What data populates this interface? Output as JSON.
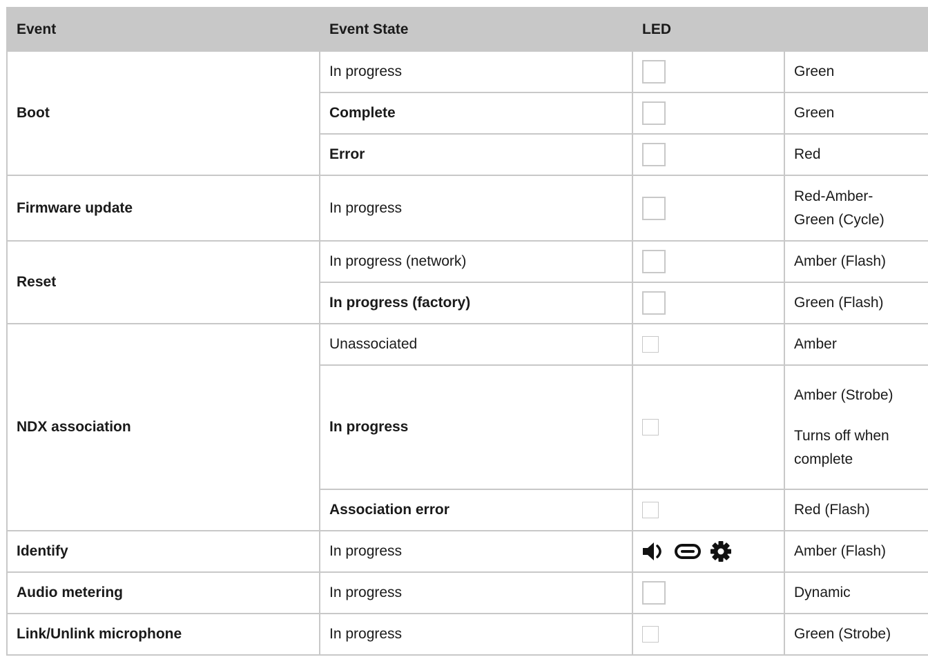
{
  "headers": {
    "event": "Event",
    "state": "Event State",
    "led": "LED"
  },
  "rows": [
    {
      "event": "Boot",
      "state": "In progress",
      "state_bold": false,
      "color": "Green",
      "swatch": "square"
    },
    {
      "event": "",
      "state": "Complete",
      "state_bold": true,
      "color": "Green",
      "swatch": "square"
    },
    {
      "event": "",
      "state": "Error",
      "state_bold": true,
      "color": "Red",
      "swatch": "square"
    },
    {
      "event": "Firmware update",
      "state": "In progress",
      "state_bold": false,
      "color_lines": [
        "Red-Amber-",
        "Green (Cycle)"
      ],
      "swatch": "square"
    },
    {
      "event": "Reset",
      "state": "In progress (network)",
      "state_bold": false,
      "color": "Amber (Flash)",
      "swatch": "square"
    },
    {
      "event": "",
      "state": "In progress (factory)",
      "state_bold": true,
      "color": "Green (Flash)",
      "swatch": "square"
    },
    {
      "event": "NDX association",
      "state": "Unassociated",
      "state_bold": false,
      "color": "Amber",
      "swatch": "small-square"
    },
    {
      "event": "",
      "state": "In progress",
      "state_bold": true,
      "color": "Amber (Strobe)",
      "color_note_lines": [
        "Turns off when",
        "complete"
      ],
      "swatch": "small-square"
    },
    {
      "event": "",
      "state": "Association error",
      "state_bold": true,
      "color": "Red (Flash)",
      "swatch": "small-square"
    },
    {
      "event": "Identify",
      "state": "In progress",
      "state_bold": false,
      "color": "Amber (Flash)",
      "icons": [
        "speaker-icon",
        "link-icon",
        "gear-icon"
      ]
    },
    {
      "event": "Audio metering",
      "state": "In progress",
      "state_bold": false,
      "color": "Dynamic",
      "swatch": "square"
    },
    {
      "event": "Link/Unlink microphone",
      "state": "In progress",
      "state_bold": false,
      "color": "Green (Strobe)",
      "swatch": "small-square"
    }
  ]
}
